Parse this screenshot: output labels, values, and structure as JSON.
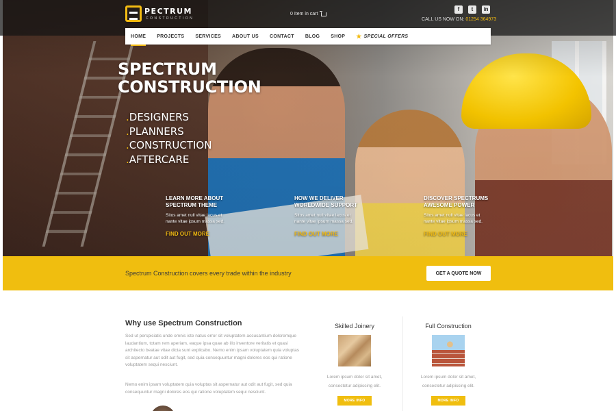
{
  "brand": {
    "name": "PECTRUM",
    "subtitle": "CONSTRUCTION",
    "accent": "#f0be0f"
  },
  "header": {
    "cart_text": "0 Item in cart",
    "phone_label": "CALL US NOW ON:",
    "phone_number": "01254 364973",
    "social": [
      {
        "icon": "facebook-icon",
        "glyph": "f"
      },
      {
        "icon": "twitter-icon",
        "glyph": "t"
      },
      {
        "icon": "linkedin-icon",
        "glyph": "in"
      }
    ]
  },
  "nav": {
    "items": [
      "HOME",
      "PROJECTS",
      "SERVICES",
      "ABOUT US",
      "CONTACT",
      "BLOG",
      "SHOP",
      "SPECIAL OFFERS"
    ],
    "active": "HOME"
  },
  "hero": {
    "title_line1": "SPECTRUM",
    "title_line2": "CONSTRUCTION",
    "list": [
      "DESIGNERS",
      "PLANNERS",
      "CONSTRUCTION",
      "AFTERCARE"
    ],
    "features": [
      {
        "title_line1": "LEARN MORE ABOUT",
        "title_line2": "SPECTRUM THEME",
        "text_line1": "Sitos amet null vitae lacus et",
        "text_line2": "nante vitae ipsum massa sed.",
        "link": "FIND OUT MORE"
      },
      {
        "title_line1": "HOW WE DELIVER",
        "title_line2": "WORLDWIDE SUPPORT",
        "text_line1": "Sitos amet null vitae lacus et",
        "text_line2": "nante vitae ipsum massa sed.",
        "link": "FIND OUT MORE"
      },
      {
        "title_line1": "DISCOVER SPECTRUMS",
        "title_line2": "AWESOME POWER",
        "text_line1": "Sitos amet null vitae lacus et",
        "text_line2": "nante vitae ipsum massa sed.",
        "link": "FIND OUT MORE"
      }
    ]
  },
  "band": {
    "text": "Spectrum Construction covers every trade within the industry",
    "button": "GET A QUOTE NOW"
  },
  "why": {
    "title": "Why use Spectrum Construction",
    "p1": "Sed ut perspiciatis unde omnis iste natus error sit voluptatem accusantium doloremque laudantium, totam rem aperiam, eaque ipsa quae ab illo inventore veritatis et quasi architecto beatae vitae dicta sunt explicabo. Nemo enim ipsam voluptatem quia voluptas sit aspernatur aut odit aut fugit, sed quia consequuntur magni dolores eos qui ratione voluptatem sequi nesciunt.",
    "p2": "Nemo enim ipsam voluptatem quia voluptas sit aspernatur aut odit aut fugit, sed quia consequuntur magni dolores eos qui ratione voluptatem sequi nesciunt."
  },
  "services": [
    {
      "title": "Skilled Joinery",
      "text_line1": "Lorem ipsum dolor sit amet,",
      "text_line2": "consectetur adipiscing elit.",
      "button": "MORE INFO"
    },
    {
      "title": "Full Construction",
      "text_line1": "Lorem ipsum dolor sit amet,",
      "text_line2": "consectetur adipiscing elit.",
      "button": "MORE INFO"
    }
  ]
}
